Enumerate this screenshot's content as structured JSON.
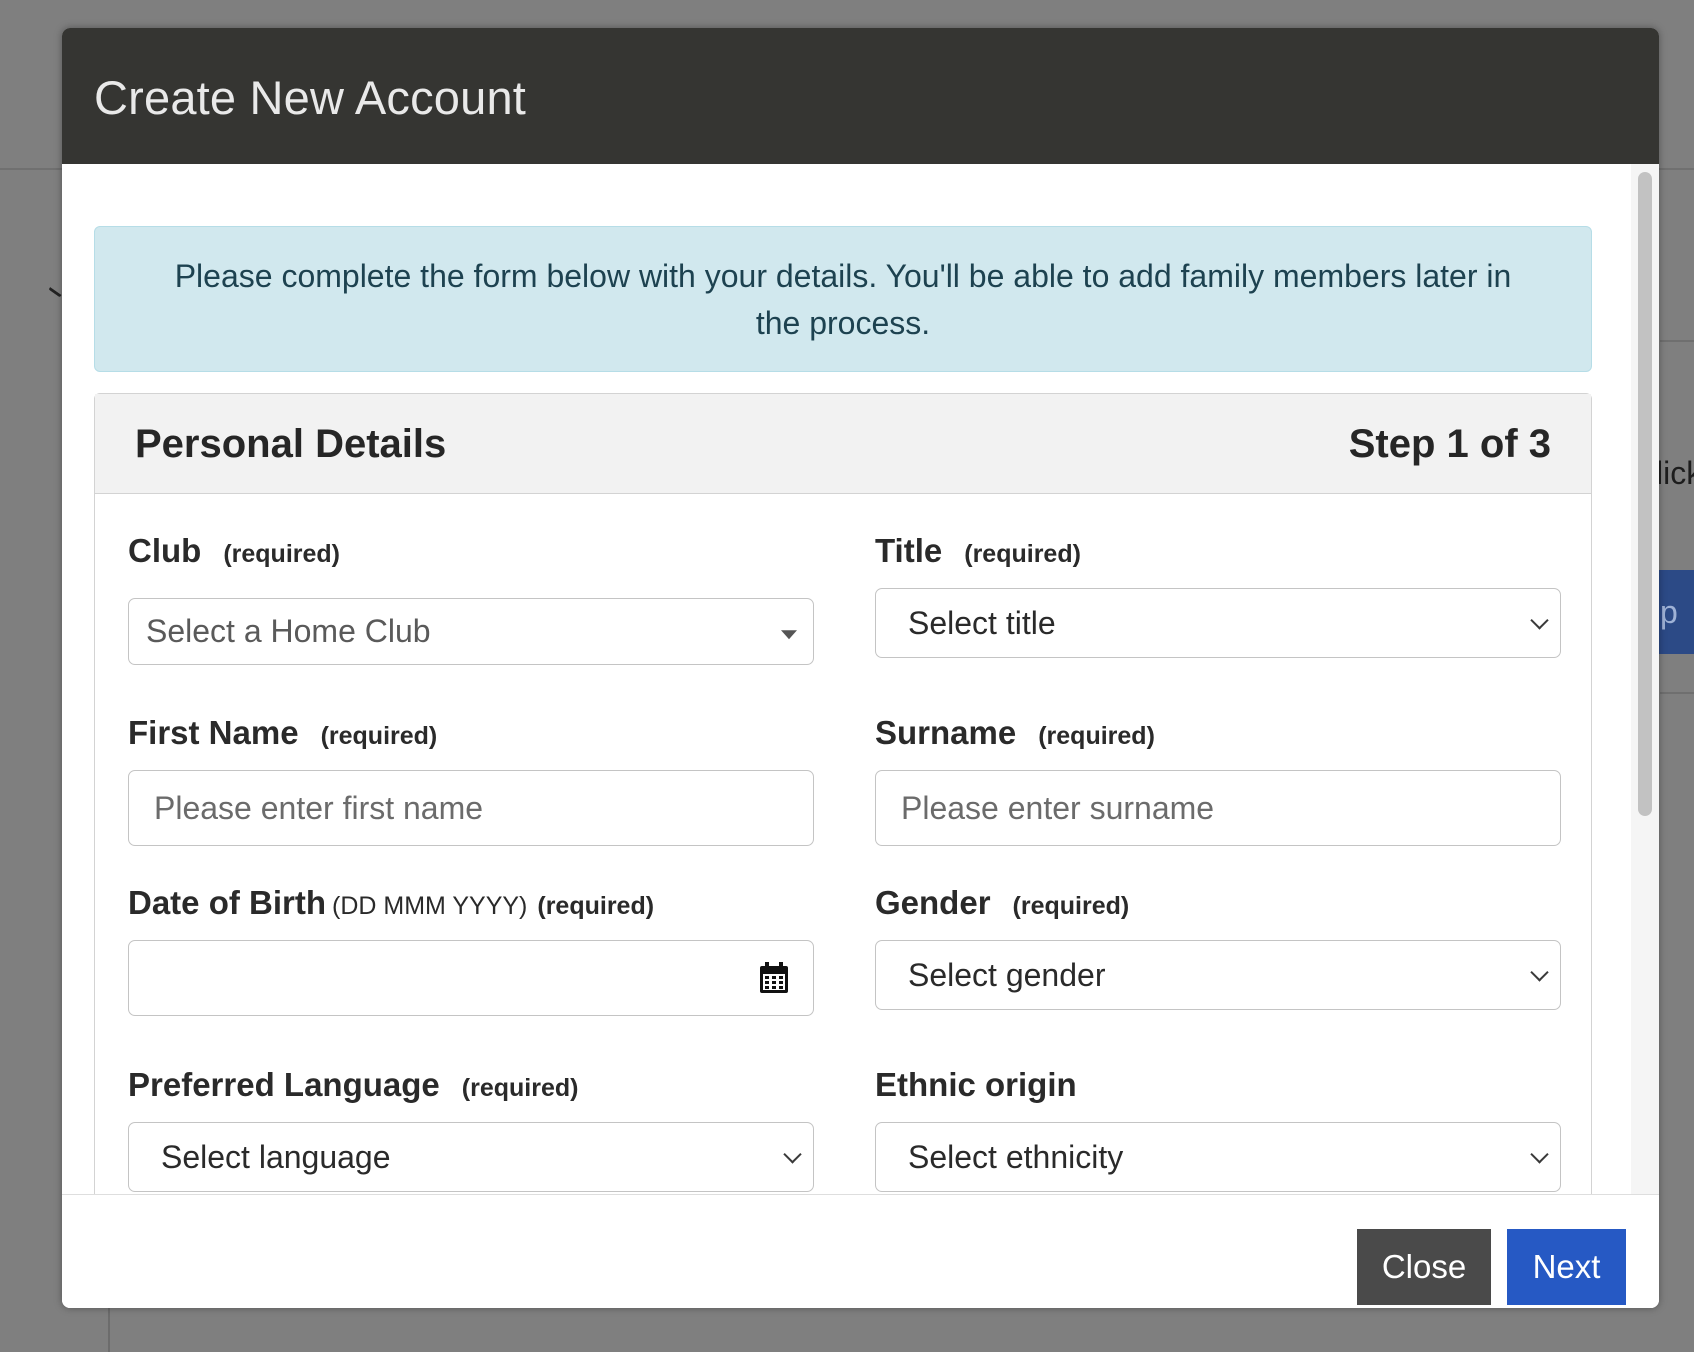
{
  "background": {
    "right_text_fragment": "lick",
    "right_button_fragment": "p"
  },
  "modal": {
    "title": "Create New Account",
    "alert_text": "Please complete the form below with your details. You'll be able to add family members later in the process.",
    "card": {
      "title": "Personal Details",
      "step": "Step 1 of 3"
    },
    "fields": {
      "club": {
        "label": "Club",
        "required": "(required)",
        "value": "Select a Home Club"
      },
      "title": {
        "label": "Title",
        "required": "(required)",
        "value": "Select title"
      },
      "first_name": {
        "label": "First Name",
        "required": "(required)",
        "placeholder": "Please enter first name"
      },
      "surname": {
        "label": "Surname",
        "required": "(required)",
        "placeholder": "Please enter surname"
      },
      "dob": {
        "label": "Date of Birth",
        "hint": "(DD MMM YYYY)",
        "required": "(required)",
        "value": ""
      },
      "gender": {
        "label": "Gender",
        "required": "(required)",
        "value": "Select gender"
      },
      "language": {
        "label": "Preferred Language",
        "required": "(required)",
        "value": "Select language"
      },
      "ethnic": {
        "label": "Ethnic origin",
        "value": "Select ethnicity"
      }
    },
    "footer": {
      "close_label": "Close",
      "next_label": "Next"
    }
  },
  "colors": {
    "overlay": "#7f7f7f",
    "header_bg": "#353532",
    "alert_bg": "#d1e8ee",
    "primary": "#2659c4",
    "secondary": "#4a4a4a"
  },
  "icons": {
    "calendar": "calendar-icon",
    "chevron": "chevron-down-icon",
    "caret": "caret-down-icon"
  }
}
